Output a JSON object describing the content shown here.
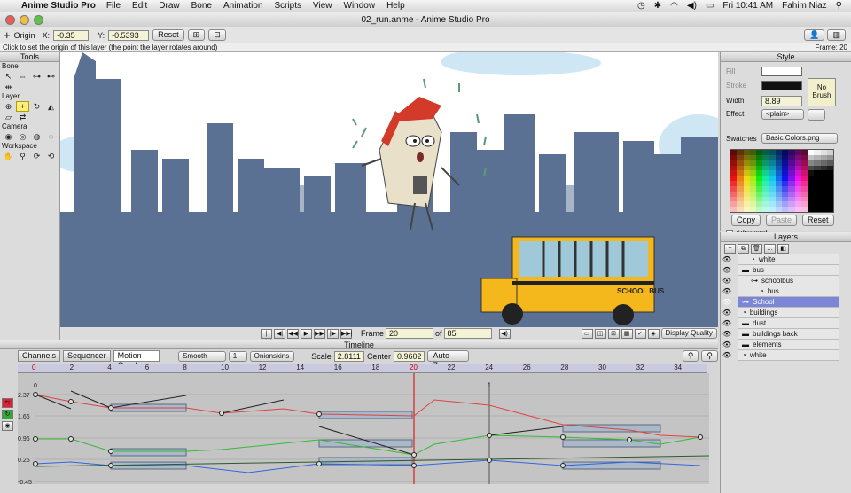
{
  "menubar": {
    "app": "Anime Studio Pro",
    "items": [
      "File",
      "Edit",
      "Draw",
      "Bone",
      "Animation",
      "Scripts",
      "View",
      "Window",
      "Help"
    ],
    "clock": "Fri 10:41 AM",
    "user": "Fahim Niaz"
  },
  "window": {
    "title": "02_run.anme - Anime Studio Pro"
  },
  "toolopts": {
    "origin_label": "Origin",
    "x_label": "X:",
    "x_value": "-0.35",
    "y_label": "Y:",
    "y_value": "-0.5393",
    "reset": "Reset"
  },
  "hint": {
    "text": "Click to set the origin of this layer (the point the layer rotates around)",
    "frame": "Frame: 20"
  },
  "tools": {
    "title": "Tools",
    "bone": "Bone",
    "layer": "Layer",
    "camera": "Camera",
    "workspace": "Workspace"
  },
  "playbar": {
    "frame_label": "Frame",
    "frame_value": "20",
    "of_label": "of",
    "of_value": "85",
    "display_quality": "Display Quality"
  },
  "timeline": {
    "title": "Timeline",
    "tabs": [
      "Channels",
      "Sequencer",
      "Motion Graph"
    ],
    "interp": "Smooth",
    "step": "1",
    "onionskins": "Onionskins",
    "scale_label": "Scale",
    "scale_value": "2.8111",
    "center_label": "Center",
    "center_value": "0.9602",
    "auto_zoom": "Auto Zoom",
    "ruler": [
      "0",
      "2",
      "4",
      "6",
      "8",
      "10",
      "12",
      "14",
      "16",
      "18",
      "20",
      "22",
      "24",
      "26",
      "28",
      "30",
      "32",
      "34"
    ],
    "yaxis": [
      "2.37",
      "1.66",
      "0.96",
      "0.26",
      "-0.45"
    ],
    "zero_label": "0",
    "mark24": "1"
  },
  "style": {
    "title": "Style",
    "fill": "Fill",
    "stroke": "Stroke",
    "width_label": "Width",
    "width_value": "8.89",
    "effect_label": "Effect",
    "effect_value": "<plain>",
    "no_brush": "No\nBrush",
    "swatches_label": "Swatches",
    "swatches_value": "Basic Colors.png",
    "copy": "Copy",
    "paste": "Paste",
    "reset": "Reset",
    "advanced": "Advanced"
  },
  "layers": {
    "title": "Layers",
    "items": [
      {
        "name": "white",
        "indent": 1,
        "icon": "group-icon",
        "sel": false
      },
      {
        "name": "bus",
        "indent": 0,
        "icon": "folder-icon",
        "sel": false
      },
      {
        "name": "schoolbus",
        "indent": 1,
        "icon": "bone-icon",
        "sel": false
      },
      {
        "name": "bus",
        "indent": 2,
        "icon": "group-icon",
        "sel": false
      },
      {
        "name": "School",
        "indent": 0,
        "icon": "bone-icon",
        "sel": true
      },
      {
        "name": "buildings",
        "indent": 0,
        "icon": "group-icon",
        "sel": false
      },
      {
        "name": "dust",
        "indent": 0,
        "icon": "folder-icon",
        "sel": false
      },
      {
        "name": "buildings back",
        "indent": 0,
        "icon": "folder-icon",
        "sel": false
      },
      {
        "name": "elements",
        "indent": 0,
        "icon": "folder-icon",
        "sel": false
      },
      {
        "name": "white",
        "indent": 0,
        "icon": "group-icon",
        "sel": false
      }
    ]
  },
  "canvas": {
    "bus_sign": "SCHOOL BUS"
  },
  "colors": {
    "accent_sel": "#7b86d6",
    "city": "#5a7193",
    "city_back": "#a8b5c6"
  }
}
